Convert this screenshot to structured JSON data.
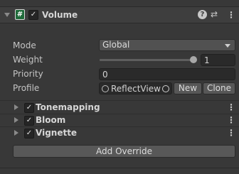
{
  "component": {
    "title": "Volume",
    "enabled_mark": "✓",
    "help_glyph": "?",
    "settings_glyph": "⇄",
    "menu_glyph": "⋮"
  },
  "fields": {
    "mode": {
      "label": "Mode",
      "value": "Global"
    },
    "weight": {
      "label": "Weight",
      "value": "1",
      "level": 1.0
    },
    "priority": {
      "label": "Priority",
      "value": "0"
    },
    "profile": {
      "label": "Profile",
      "value": "ReflectView",
      "new_label": "New",
      "clone_label": "Clone"
    }
  },
  "overrides": [
    {
      "label": "Tonemapping"
    },
    {
      "label": "Bloom"
    },
    {
      "label": "Vignette"
    }
  ],
  "add_override_label": "Add Override",
  "icons": {
    "foldout": "triangle-icon",
    "script": "script-icon",
    "help": "help-icon",
    "preset": "preset-icon",
    "menu": "kebab-menu-icon",
    "profile_asset": "asset-icon",
    "object_picker": "object-picker-icon"
  },
  "colors": {
    "background": "#383838",
    "field": "#2a2a2a",
    "button": "#575757"
  }
}
